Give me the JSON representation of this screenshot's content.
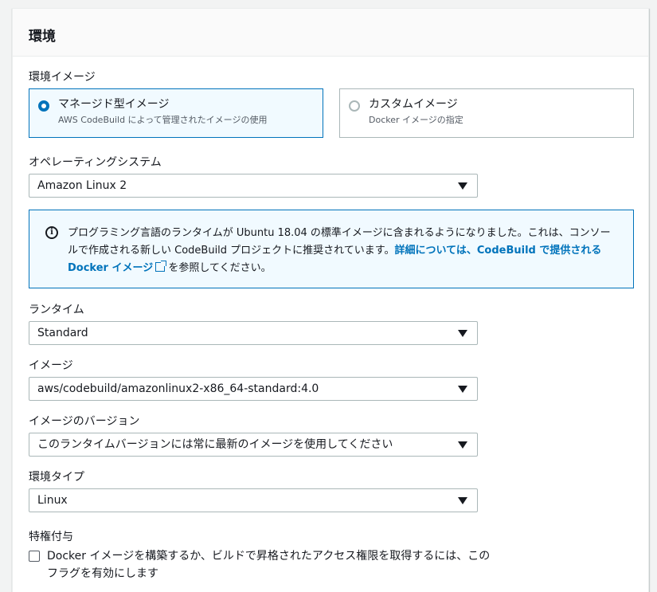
{
  "section": {
    "title": "環境"
  },
  "image_type": {
    "label": "環境イメージ",
    "options": [
      {
        "title": "マネージド型イメージ",
        "description": "AWS CodeBuild によって管理されたイメージの使用",
        "selected": true
      },
      {
        "title": "カスタムイメージ",
        "description": "Docker イメージの指定",
        "selected": false
      }
    ]
  },
  "os": {
    "label": "オペレーティングシステム",
    "value": "Amazon Linux 2"
  },
  "info": {
    "text": "プログラミング言語のランタイムが Ubuntu 18.04 の標準イメージに含まれるようになりました。これは、コンソールで作成される新しい CodeBuild プロジェクトに推奨されています。",
    "link": "詳細については、CodeBuild で提供される Docker イメージ",
    "suffix": "を参照してください。"
  },
  "runtime": {
    "label": "ランタイム",
    "value": "Standard"
  },
  "image": {
    "label": "イメージ",
    "value": "aws/codebuild/amazonlinux2-x86_64-standard:4.0"
  },
  "image_version": {
    "label": "イメージのバージョン",
    "value": "このランタイムバージョンには常に最新のイメージを使用してください"
  },
  "env_type": {
    "label": "環境タイプ",
    "value": "Linux"
  },
  "privileged": {
    "label": "特権付与",
    "checkbox_label": "Docker イメージを構築するか、ビルドで昇格されたアクセス権限を取得するには、このフラグを有効にします",
    "checked": false
  }
}
